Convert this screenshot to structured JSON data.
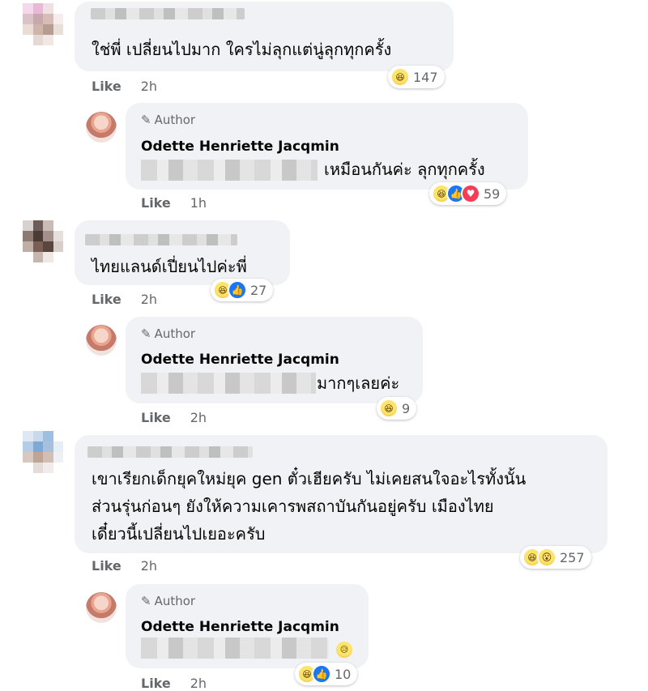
{
  "comments": [
    {
      "text_lines": [
        "ใช่พี่ เปลี่ยนไปมาก ใครไม่ลุกแต่นู่ลุกทุกครั้ง"
      ],
      "meta": {
        "like": "Like",
        "time": "2h"
      },
      "reactions": {
        "icons": [
          "haha-icon"
        ],
        "count": "147"
      },
      "reply": {
        "badge": "Author",
        "name": "Odette Henriette Jacqmin",
        "text": "เหมือนกันค่ะ ลุกทุกครั้ง",
        "meta": {
          "like": "Like",
          "time": "1h"
        },
        "reactions": {
          "icons": [
            "haha-icon",
            "like-icon",
            "love-icon"
          ],
          "count": "59"
        }
      }
    },
    {
      "text_lines": [
        "ไทยแลนด์เปี่ยนไปค่ะพี่"
      ],
      "meta": {
        "like": "Like",
        "time": "2h"
      },
      "reactions": {
        "icons": [
          "haha-icon",
          "like-icon"
        ],
        "count": "27"
      },
      "reply": {
        "badge": "Author",
        "name": "Odette Henriette Jacqmin",
        "text": "มากๆเลยค่ะ",
        "meta": {
          "like": "Like",
          "time": "2h"
        },
        "reactions": {
          "icons": [
            "haha-icon"
          ],
          "count": "9"
        }
      }
    },
    {
      "text_lines": [
        "เขาเรียกเด็กยุคใหม่ยุค gen ตั๋วเฮียครับ ไม่เคยสนใจอะไรทั้งนั้น",
        "ส่วนรุ่นก่อนๆ ยังให้ความเคารพสถาบันกันอยู่ครับ เมืองไทย",
        "เดี๋ยวนี้เปลี่ยนไปเยอะครับ"
      ],
      "meta": {
        "like": "Like",
        "time": "2h"
      },
      "reactions": {
        "icons": [
          "haha-icon",
          "wow-icon"
        ],
        "count": "257"
      },
      "reply": {
        "badge": "Author",
        "name": "Odette Henriette Jacqmin",
        "text": "",
        "meta": {
          "like": "Like",
          "time": "2h"
        },
        "reactions": {
          "icons": [
            "haha-icon",
            "like-icon"
          ],
          "count": "10"
        }
      }
    }
  ],
  "colors": {
    "bubble": "#f0f2f5",
    "meta_text": "#65676b",
    "like_blue": "#1877f2",
    "love_red": "#f33e58",
    "haha_yellow": "#f7b125"
  }
}
